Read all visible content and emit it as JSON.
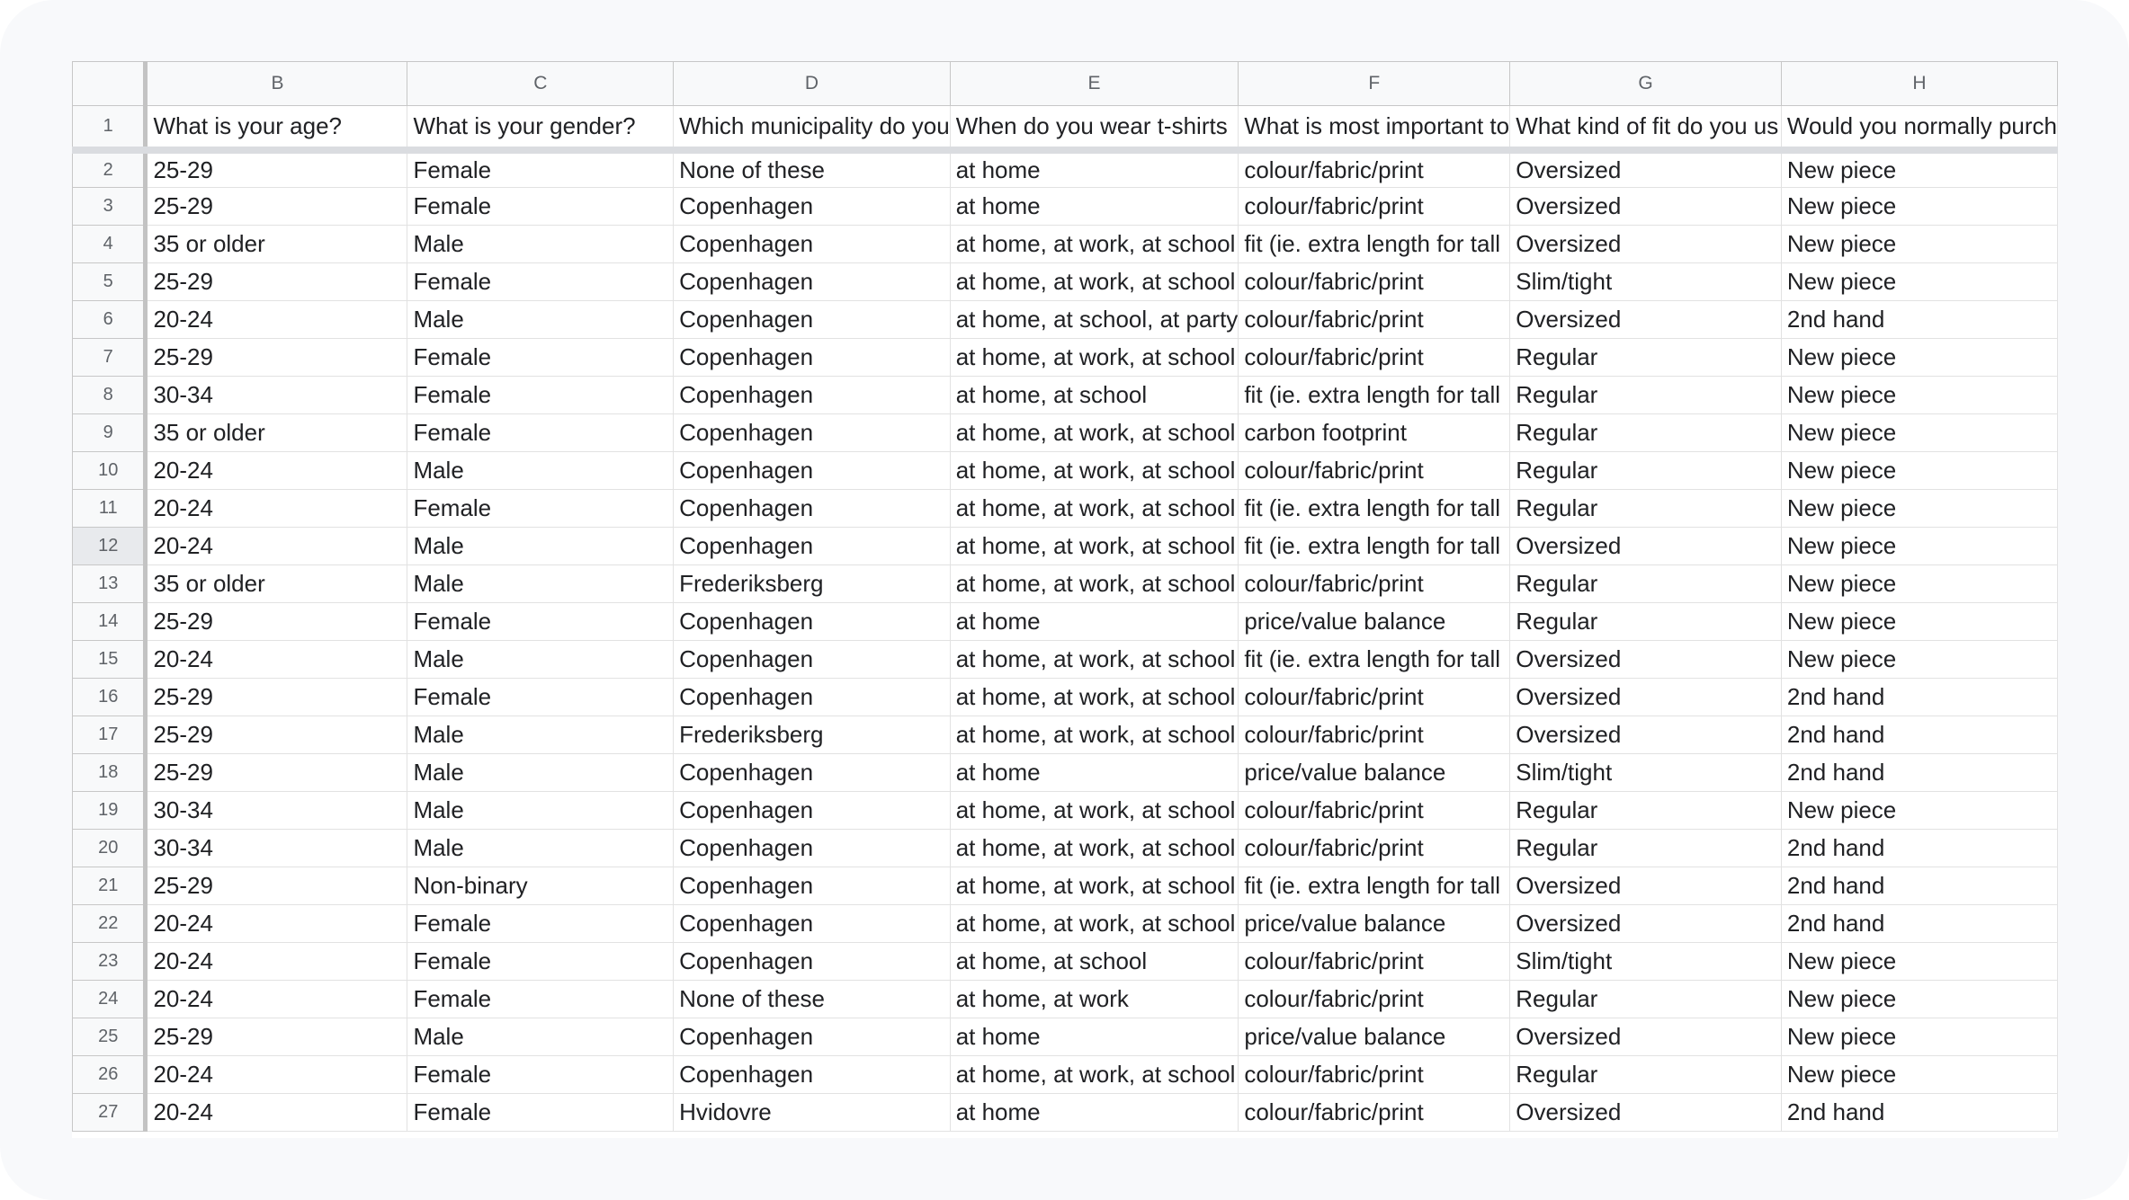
{
  "columns": [
    "B",
    "C",
    "D",
    "E",
    "F",
    "G",
    "H"
  ],
  "selected_row": "12",
  "header_row": {
    "num": "1",
    "cells": [
      "What is your age?",
      "What is your gender?",
      "Which municipality do you",
      "When do you wear t-shirts",
      "What is most important to",
      "What kind of fit do you us",
      "Would you normally purch"
    ]
  },
  "rows": [
    {
      "num": "2",
      "cells": [
        "25-29",
        "Female",
        "None of these",
        "at home",
        "colour/fabric/print",
        "Oversized",
        "New piece"
      ]
    },
    {
      "num": "3",
      "cells": [
        "25-29",
        "Female",
        "Copenhagen",
        "at home",
        "colour/fabric/print",
        "Oversized",
        "New piece"
      ]
    },
    {
      "num": "4",
      "cells": [
        "35 or older",
        "Male",
        "Copenhagen",
        "at home, at work, at school",
        "fit (ie. extra length for tall",
        "Oversized",
        "New piece"
      ]
    },
    {
      "num": "5",
      "cells": [
        "25-29",
        "Female",
        "Copenhagen",
        "at home, at work, at school",
        "colour/fabric/print",
        "Slim/tight",
        "New piece"
      ]
    },
    {
      "num": "6",
      "cells": [
        "20-24",
        "Male",
        "Copenhagen",
        "at home, at school, at party",
        "colour/fabric/print",
        "Oversized",
        "2nd hand"
      ]
    },
    {
      "num": "7",
      "cells": [
        "25-29",
        "Female",
        "Copenhagen",
        "at home, at work, at school",
        "colour/fabric/print",
        "Regular",
        "New piece"
      ]
    },
    {
      "num": "8",
      "cells": [
        "30-34",
        "Female",
        "Copenhagen",
        "at home, at school",
        "fit (ie. extra length for tall",
        "Regular",
        "New piece"
      ]
    },
    {
      "num": "9",
      "cells": [
        "35 or older",
        "Female",
        "Copenhagen",
        "at home, at work, at school",
        "carbon footprint",
        "Regular",
        "New piece"
      ]
    },
    {
      "num": "10",
      "cells": [
        "20-24",
        "Male",
        "Copenhagen",
        "at home, at work, at school",
        "colour/fabric/print",
        "Regular",
        "New piece"
      ]
    },
    {
      "num": "11",
      "cells": [
        "20-24",
        "Female",
        "Copenhagen",
        "at home, at work, at school",
        "fit (ie. extra length for tall",
        "Regular",
        "New piece"
      ]
    },
    {
      "num": "12",
      "cells": [
        "20-24",
        "Male",
        "Copenhagen",
        "at home, at work, at school",
        "fit (ie. extra length for tall",
        "Oversized",
        "New piece"
      ]
    },
    {
      "num": "13",
      "cells": [
        "35 or older",
        "Male",
        "Frederiksberg",
        "at home, at work, at school",
        "colour/fabric/print",
        "Regular",
        "New piece"
      ]
    },
    {
      "num": "14",
      "cells": [
        "25-29",
        "Female",
        "Copenhagen",
        "at home",
        "price/value balance",
        "Regular",
        "New piece"
      ]
    },
    {
      "num": "15",
      "cells": [
        "20-24",
        "Male",
        "Copenhagen",
        "at home, at work, at school",
        "fit (ie. extra length for tall",
        "Oversized",
        "New piece"
      ]
    },
    {
      "num": "16",
      "cells": [
        "25-29",
        "Female",
        "Copenhagen",
        "at home, at work, at school",
        "colour/fabric/print",
        "Oversized",
        "2nd hand"
      ]
    },
    {
      "num": "17",
      "cells": [
        "25-29",
        "Male",
        "Frederiksberg",
        "at home, at work, at school",
        "colour/fabric/print",
        "Oversized",
        "2nd hand"
      ]
    },
    {
      "num": "18",
      "cells": [
        "25-29",
        "Male",
        "Copenhagen",
        "at home",
        "price/value balance",
        "Slim/tight",
        "2nd hand"
      ]
    },
    {
      "num": "19",
      "cells": [
        "30-34",
        "Male",
        "Copenhagen",
        "at home, at work, at school",
        "colour/fabric/print",
        "Regular",
        "New piece"
      ]
    },
    {
      "num": "20",
      "cells": [
        "30-34",
        "Male",
        "Copenhagen",
        "at home, at work, at school",
        "colour/fabric/print",
        "Regular",
        "2nd hand"
      ]
    },
    {
      "num": "21",
      "cells": [
        "25-29",
        "Non-binary",
        "Copenhagen",
        "at home, at work, at school",
        "fit (ie. extra length for tall",
        "Oversized",
        "2nd hand"
      ]
    },
    {
      "num": "22",
      "cells": [
        "20-24",
        "Female",
        "Copenhagen",
        "at home, at work, at school",
        "price/value balance",
        "Oversized",
        "2nd hand"
      ]
    },
    {
      "num": "23",
      "cells": [
        "20-24",
        "Female",
        "Copenhagen",
        "at home, at school",
        "colour/fabric/print",
        "Slim/tight",
        "New piece"
      ]
    },
    {
      "num": "24",
      "cells": [
        "20-24",
        "Female",
        "None of these",
        "at home, at work",
        "colour/fabric/print",
        "Regular",
        "New piece"
      ]
    },
    {
      "num": "25",
      "cells": [
        "25-29",
        "Male",
        "Copenhagen",
        "at home",
        "price/value balance",
        "Oversized",
        "New piece"
      ]
    },
    {
      "num": "26",
      "cells": [
        "20-24",
        "Female",
        "Copenhagen",
        "at home, at work, at school",
        "colour/fabric/print",
        "Regular",
        "New piece"
      ]
    },
    {
      "num": "27",
      "cells": [
        "20-24",
        "Female",
        "Hvidovre",
        "at home",
        "colour/fabric/print",
        "Oversized",
        "2nd hand"
      ]
    }
  ]
}
